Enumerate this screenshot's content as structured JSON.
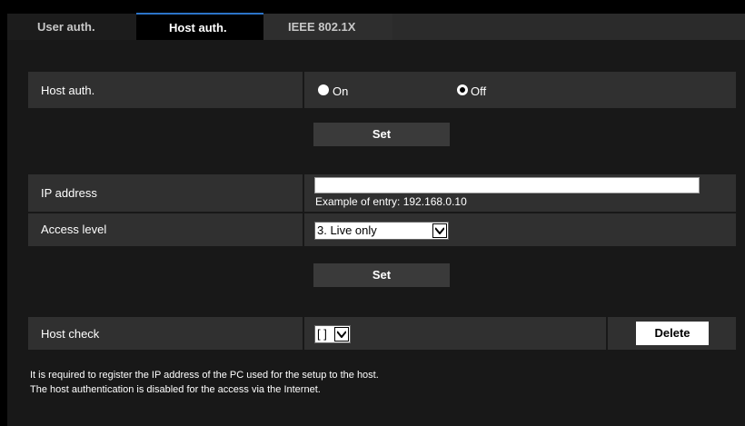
{
  "tabs": [
    {
      "label": "User auth."
    },
    {
      "label": "Host auth."
    },
    {
      "label": "IEEE 802.1X"
    }
  ],
  "host_auth": {
    "label": "Host auth.",
    "options": [
      {
        "label": "On",
        "selected": false
      },
      {
        "label": "Off",
        "selected": true
      }
    ],
    "set_label": "Set"
  },
  "ip_address": {
    "label": "IP address",
    "value": "",
    "hint": "Example of entry: 192.168.0.10"
  },
  "access_level": {
    "label": "Access level",
    "selected": "3. Live only"
  },
  "registration": {
    "set_label": "Set"
  },
  "host_check": {
    "label": "Host check",
    "selected": "[ ]",
    "delete_label": "Delete"
  },
  "notes": [
    "It is required to register the IP address of the PC used for the setup to the host.",
    "The host authentication is disabled for the access via the Internet."
  ]
}
